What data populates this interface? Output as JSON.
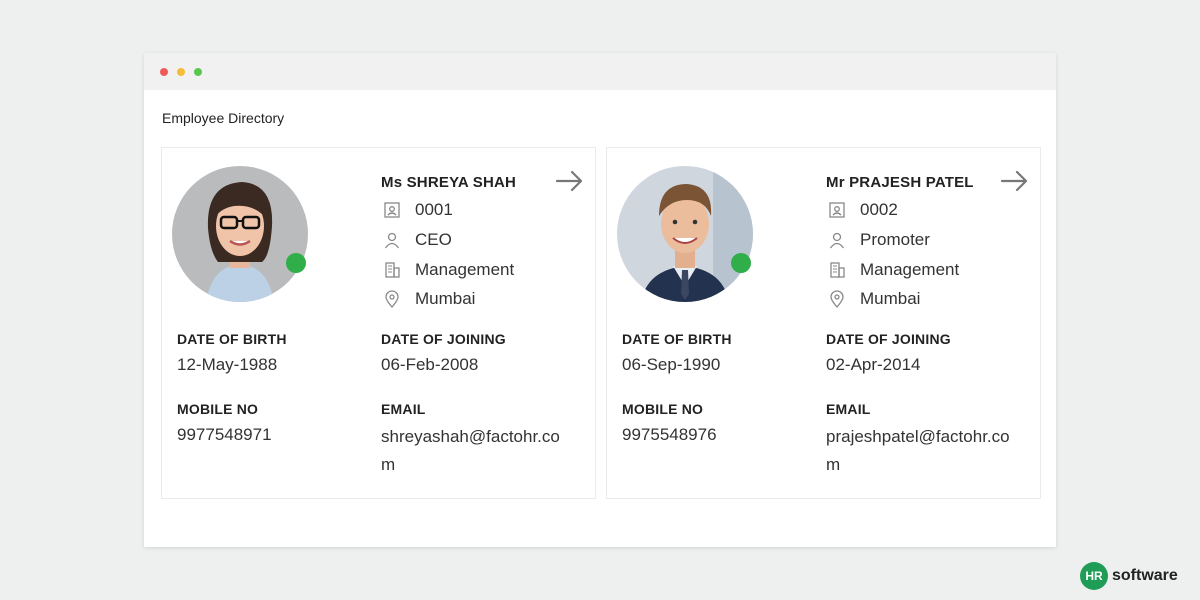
{
  "window": {
    "title": "Employee Directory"
  },
  "employees": [
    {
      "name": "Ms SHREYA SHAH",
      "id": "0001",
      "designation": "CEO",
      "department": "Management",
      "location": "Mumbai",
      "dob_label": "DATE OF BIRTH",
      "dob": "12-May-1988",
      "doj_label": "DATE OF JOINING",
      "doj": "06-Feb-2008",
      "mobile_label": "MOBILE NO",
      "mobile": "9977548971",
      "email_label": "EMAIL",
      "email": "shreyashah@factohr.com",
      "status_color": "#2fae4a"
    },
    {
      "name": "Mr PRAJESH PATEL",
      "id": "0002",
      "designation": "Promoter",
      "department": "Management",
      "location": "Mumbai",
      "dob_label": "DATE OF BIRTH",
      "dob": "06-Sep-1990",
      "doj_label": "DATE OF JOINING",
      "doj": "02-Apr-2014",
      "mobile_label": "MOBILE NO",
      "mobile": "9975548976",
      "email_label": "EMAIL",
      "email": "prajeshpatel@factohr.com",
      "status_color": "#2fae4a"
    }
  ],
  "brand": {
    "badge": "HR",
    "text": "software",
    "color": "#1f9d57"
  }
}
